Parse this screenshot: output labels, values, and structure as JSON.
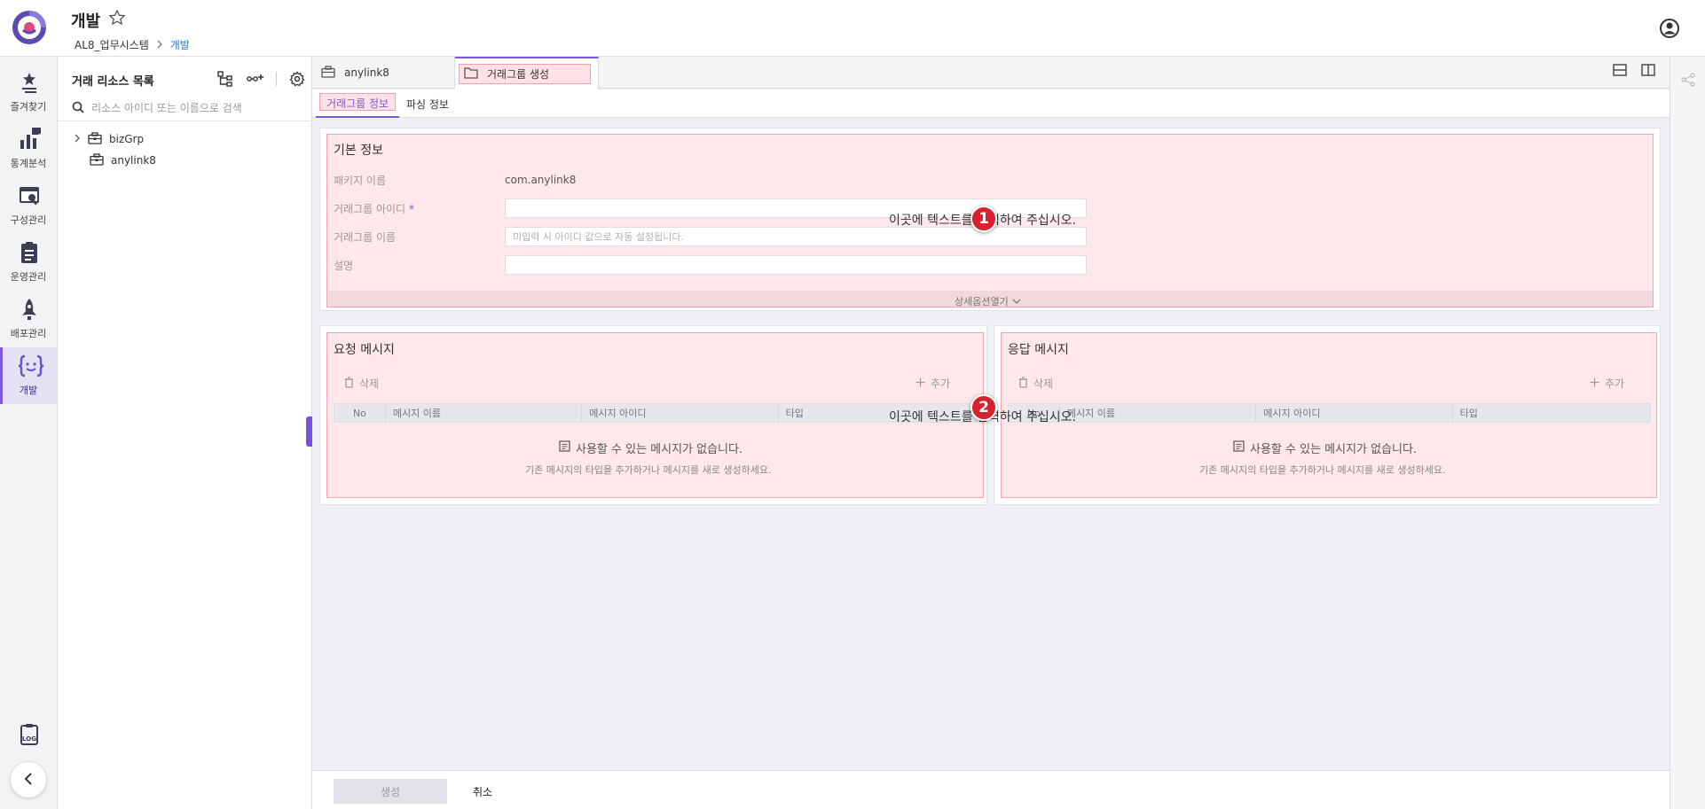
{
  "header": {
    "title": "개발",
    "breadcrumb": [
      "AL8_업무시스템",
      "개발"
    ]
  },
  "leftnav": {
    "items": [
      {
        "label": "즐겨찾기",
        "icon": "star-list-icon"
      },
      {
        "label": "통계분석",
        "icon": "chart-icon"
      },
      {
        "label": "구성관리",
        "icon": "config-icon"
      },
      {
        "label": "운영관리",
        "icon": "clipboard-icon"
      },
      {
        "label": "배포관리",
        "icon": "rocket-icon"
      },
      {
        "label": "개발",
        "icon": "code-braces-icon",
        "active": true
      }
    ]
  },
  "tree": {
    "title": "거래 리소스 목록",
    "search_placeholder": "리소스 아이디 또는 이름으로 검색",
    "nodes": [
      {
        "label": "bizGrp",
        "expandable": true
      },
      {
        "label": "anylink8",
        "expandable": false
      }
    ]
  },
  "tabs": [
    {
      "label": "anylink8",
      "active": false
    },
    {
      "label": "거래그룹 생성",
      "active": true
    }
  ],
  "subtabs": [
    {
      "label": "거래그룹 정보",
      "active": true
    },
    {
      "label": "파싱 정보",
      "active": false
    }
  ],
  "basic_info": {
    "title": "기본 정보",
    "package_label": "패키지 이름",
    "package_value": "com.anylink8",
    "group_id_label": "거래그룹 아이디",
    "required_mark": "*",
    "group_name_label": "거래그룹 이름",
    "group_name_placeholder": "미입력 시 아이디 값으로 자동 설정됩니다.",
    "desc_label": "설명",
    "expand_label": "상세옵션열기"
  },
  "request": {
    "title": "요청 메시지",
    "delete_label": "삭제",
    "add_label": "추가",
    "columns": [
      "No",
      "메시지 이름",
      "메시지 아이디",
      "타입"
    ],
    "empty_title": "사용할 수 있는 메시지가 없습니다.",
    "empty_desc": "기존 메시지의 타입을 추가하거나 메시지를 새로 생성하세요."
  },
  "response": {
    "title": "응답 메시지",
    "delete_label": "삭제",
    "add_label": "추가",
    "columns": [
      "No",
      "메시지 이름",
      "메시지 아이디",
      "타입"
    ],
    "empty_title": "사용할 수 있는 메시지가 없습니다.",
    "empty_desc": "기존 메시지의 타입을 추가하거나 메시지를 새로 생성하세요."
  },
  "annotations": [
    {
      "number": "1",
      "text": "이곳에 텍스트를 입력하여 주십시오."
    },
    {
      "number": "2",
      "text": "이곳에 텍스트를 입력하여 주십시오."
    }
  ],
  "footer": {
    "create_label": "생성",
    "cancel_label": "취소"
  },
  "colors": {
    "accent": "#7b5bd6",
    "highlight": "#ff788c",
    "badge": "#d8202f",
    "link": "#2a78d6"
  }
}
